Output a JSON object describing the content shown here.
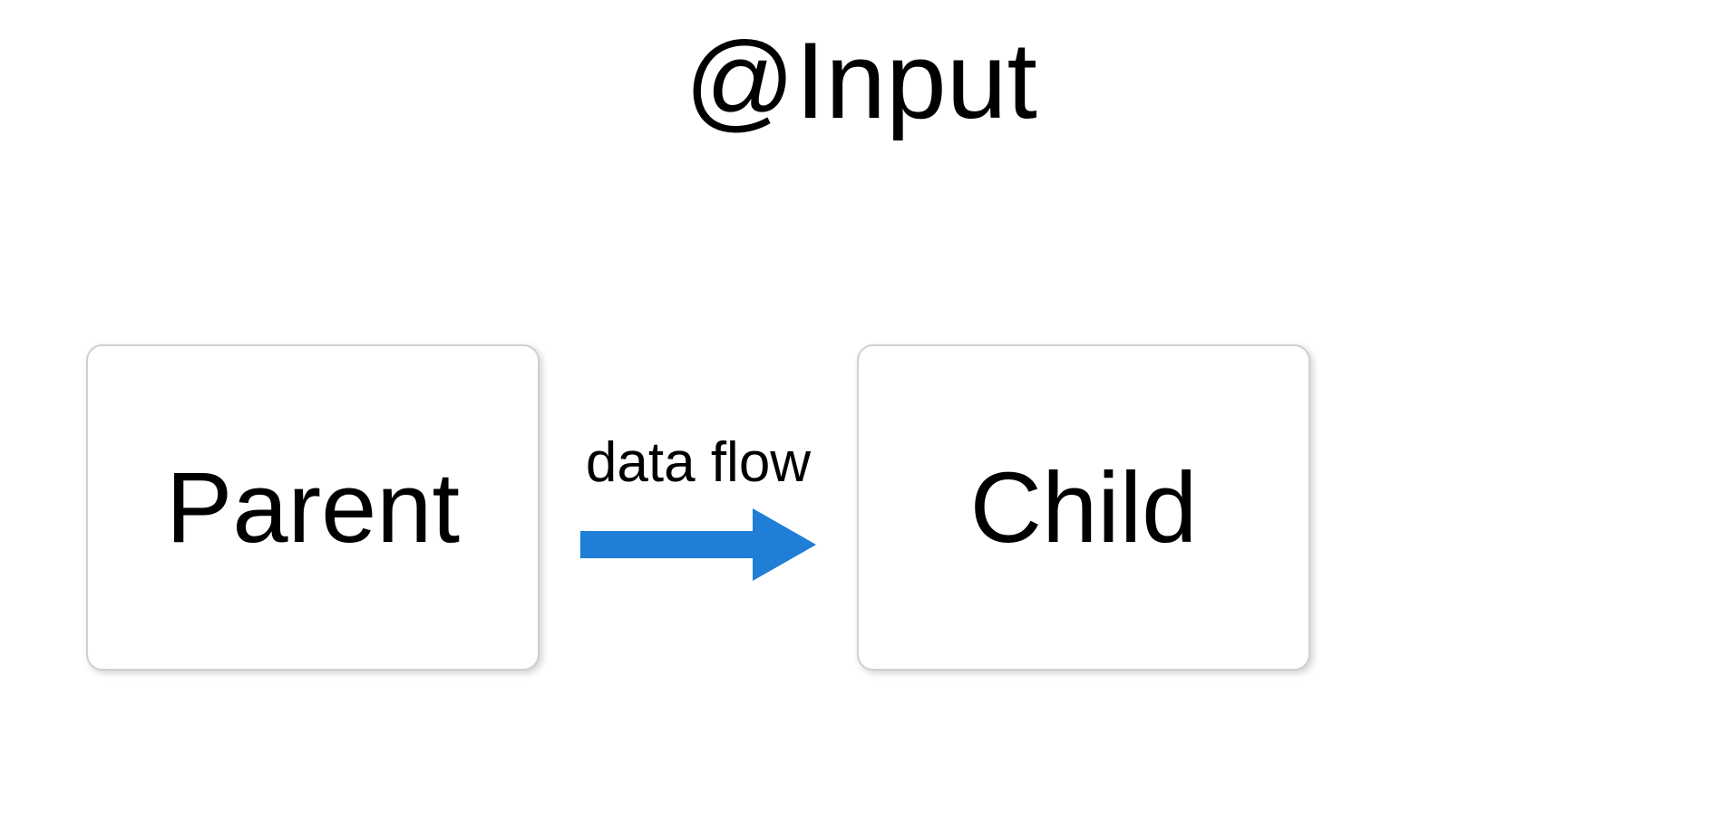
{
  "title": "@Input",
  "diagram": {
    "left_node": "Parent",
    "right_node": "Child",
    "arrow_label": "data flow",
    "arrow_color": "#1f7ed6"
  }
}
